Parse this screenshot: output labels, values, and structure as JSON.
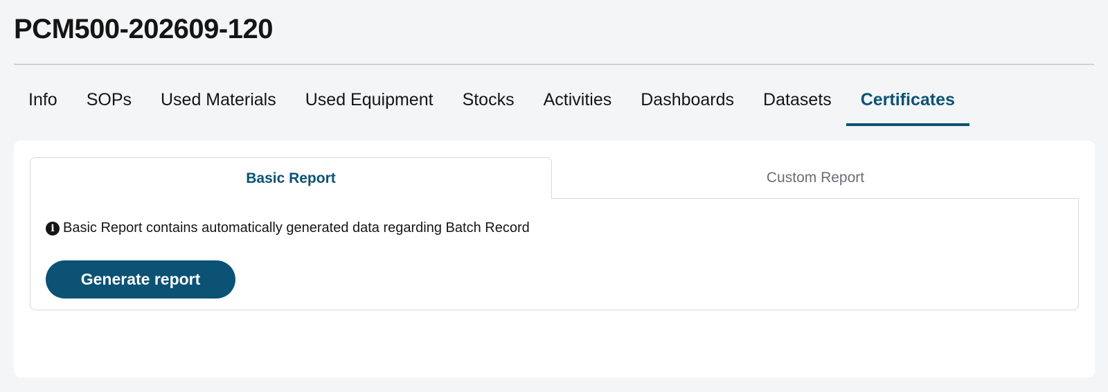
{
  "header": {
    "title": "PCM500-202609-120"
  },
  "nav": {
    "tabs": [
      {
        "label": "Info"
      },
      {
        "label": "SOPs"
      },
      {
        "label": "Used Materials"
      },
      {
        "label": "Used Equipment"
      },
      {
        "label": "Stocks"
      },
      {
        "label": "Activities"
      },
      {
        "label": "Dashboards"
      },
      {
        "label": "Datasets"
      },
      {
        "label": "Certificates"
      }
    ],
    "active": "Certificates"
  },
  "report": {
    "tabs": [
      {
        "label": "Basic Report"
      },
      {
        "label": "Custom Report"
      }
    ],
    "active": "Basic Report",
    "info_icon": "info-circle-icon",
    "info_text": "Basic Report contains automatically generated data regarding Batch Record",
    "generate_label": "Generate report"
  },
  "colors": {
    "accent": "#0b5274",
    "background": "#f4f5f7",
    "card": "#ffffff",
    "muted_text": "#6a6e73"
  }
}
